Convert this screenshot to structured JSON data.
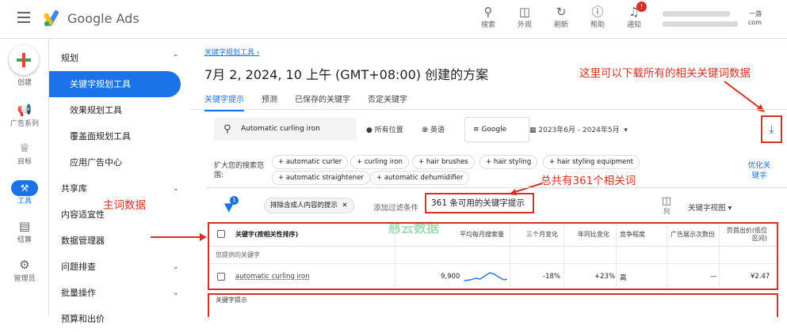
{
  "header": {
    "brand": "Google Ads",
    "icons": [
      {
        "label": "搜索",
        "icon": "search-icon"
      },
      {
        "label": "外观",
        "icon": "appearance-icon"
      },
      {
        "label": "刷新",
        "icon": "refresh-icon"
      },
      {
        "label": "帮助",
        "icon": "help-icon"
      },
      {
        "label": "通知",
        "icon": "bell-icon"
      }
    ],
    "notif_count": "!",
    "account_line1": "一游",
    "account_line2": "com"
  },
  "rail": [
    {
      "label": "创建",
      "icon": "create-icon"
    },
    {
      "label": "广告系列",
      "icon": "megaphone-icon"
    },
    {
      "label": "目标",
      "icon": "trophy-icon"
    },
    {
      "label": "工具",
      "icon": "tools-icon"
    },
    {
      "label": "结算",
      "icon": "card-icon"
    },
    {
      "label": "管理员",
      "icon": "gear-icon"
    }
  ],
  "nav": {
    "planning": "规划",
    "keyword_planner": "关键字规划工具",
    "performance_planner": "效果规划工具",
    "reach_planner": "覆盖面规划工具",
    "app_center": "应用广告中心",
    "shared_library": "共享库",
    "content_suitability": "内容适宜性",
    "data_manager": "数据管理器",
    "troubleshooting": "问题排查",
    "bulk_actions": "批量操作",
    "budgets": "预算和出价"
  },
  "main": {
    "breadcrumb": "关键字规划工具",
    "title": "7月 2, 2024, 10 上午 (GMT+08:00) 创建的方案",
    "tabs": [
      "关键字提示",
      "预测",
      "已保存的关键字",
      "否定关键字"
    ],
    "search_value": "Automatic curling iron",
    "location": "所有位置",
    "language": "英语",
    "engine": "Google",
    "date_range": "2023年6月 - 2024年5月",
    "expand_label": "扩大您的搜索范围:",
    "chips": [
      "automatic curler",
      "curling iron",
      "hair brushes",
      "hair styling",
      "hair styling equipment",
      "automatic straightener",
      "automatic dehumidifier"
    ],
    "refine": "优化关键字",
    "filter_badge": "1",
    "exclude_chip": "排除含成人内容的提示",
    "add_filter": "添加过滤条件",
    "count_text": "361 条可用的关键字提示",
    "columns_label": "列",
    "view_label": "关键字视图",
    "watermark": "慈云数据"
  },
  "annotations": {
    "download_note": "这里可以下载所有的相关关键词数据",
    "count_note": "总共有361个相关词",
    "main_note": "主词数据"
  },
  "table": {
    "headers": [
      "关键字(按相关性排序)",
      "平均每月搜索量",
      "三个月变化",
      "年同比变化",
      "竞争程度",
      "广告展示次数份",
      "页首出价(低位区间)"
    ],
    "group_provided": "您提供的关键字",
    "group_ideas": "关键字提示",
    "rows": [
      {
        "keyword": "automatic curling iron",
        "searches": "9,900",
        "three_month": "-18%",
        "yoy": "+23%",
        "competition": "高",
        "impression_share": "—",
        "bid_low": "¥2.47"
      }
    ]
  },
  "colors": {
    "accent": "#1a73e8",
    "annotation": "#d93025"
  }
}
